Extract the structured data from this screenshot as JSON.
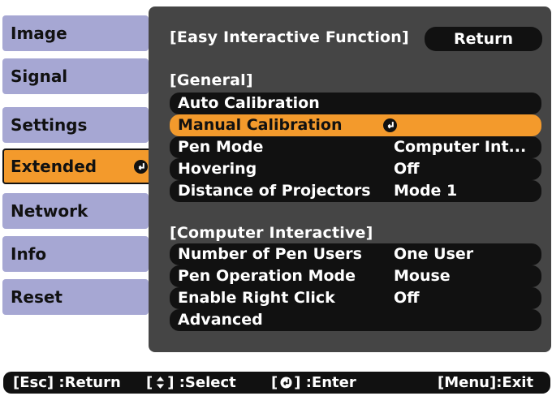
{
  "sidebar": {
    "items": [
      {
        "label": "Image",
        "active": false
      },
      {
        "label": "Signal",
        "active": false
      },
      {
        "label": "Settings",
        "active": false
      },
      {
        "label": "Extended",
        "active": true
      },
      {
        "label": "Network",
        "active": false
      },
      {
        "label": "Info",
        "active": false
      },
      {
        "label": "Reset",
        "active": false
      }
    ]
  },
  "panel": {
    "title": "[Easy Interactive Function]",
    "return_label": "Return",
    "general_heading": "[General]",
    "general_items": [
      {
        "label": "Auto Calibration",
        "value": ""
      },
      {
        "label": "Manual Calibration",
        "value": "",
        "selected": true
      },
      {
        "label": "Pen Mode",
        "value": "Computer Int..."
      },
      {
        "label": "Hovering",
        "value": "Off"
      },
      {
        "label": "Distance of Projectors",
        "value": "Mode 1"
      }
    ],
    "computer_heading": "[Computer Interactive]",
    "computer_items": [
      {
        "label": "Number of Pen Users",
        "value": "One User"
      },
      {
        "label": "Pen Operation Mode",
        "value": "Mouse"
      },
      {
        "label": "Enable Right Click",
        "value": "Off"
      },
      {
        "label": "Advanced",
        "value": ""
      }
    ]
  },
  "footer": {
    "esc_hint": "[Esc] :Return",
    "select_hint_prefix": "[",
    "select_hint_suffix": "] :Select",
    "enter_hint_prefix": "[",
    "enter_hint_suffix": "] :Enter",
    "menu_hint": "[Menu]:Exit"
  },
  "colors": {
    "accent": "#f39a2c",
    "sidebar": "#a6a7d3",
    "panel": "#454545",
    "row": "#111111"
  },
  "icons": {
    "enter": "enter-icon",
    "updown": "up-down-arrow-icon"
  }
}
